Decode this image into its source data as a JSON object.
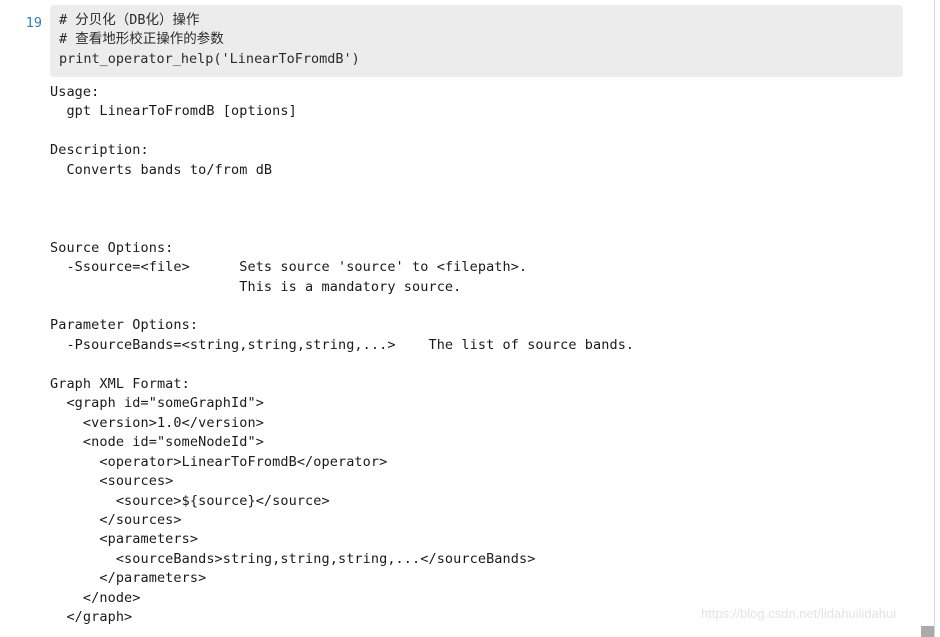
{
  "notebook": {
    "cell": {
      "prompt_label": "19",
      "input_code": "# 分贝化（DB化）操作\n# 查看地形校正操作的参数\nprint_operator_help('LinearToFromdB')",
      "input_lines": [
        "# 分贝化（DB化）操作",
        "# 查看地形校正操作的参数",
        "print_operator_help('LinearToFromdB')"
      ],
      "output_text": "Usage:\n  gpt LinearToFromdB [options]\n\nDescription:\n  Converts bands to/from dB\n\n\n\nSource Options:\n  -Ssource=<file>      Sets source 'source' to <filepath>.\n                       This is a mandatory source.\n\nParameter Options:\n  -PsourceBands=<string,string,string,...>    The list of source bands.\n\nGraph XML Format:\n  <graph id=\"someGraphId\">\n    <version>1.0</version>\n    <node id=\"someNodeId\">\n      <operator>LinearToFromdB</operator>\n      <sources>\n        <source>${source}</source>\n      </sources>\n      <parameters>\n        <sourceBands>string,string,string,...</sourceBands>\n      </parameters>\n    </node>\n  </graph>",
      "output_lines": [
        "Usage:",
        "  gpt LinearToFromdB [options]",
        "",
        "Description:",
        "  Converts bands to/from dB",
        "",
        "",
        "",
        "Source Options:",
        "  -Ssource=<file>      Sets source 'source' to <filepath>.",
        "                       This is a mandatory source.",
        "",
        "Parameter Options:",
        "  -PsourceBands=<string,string,string,...>    The list of source bands.",
        "",
        "Graph XML Format:",
        "  <graph id=\"someGraphId\">",
        "    <version>1.0</version>",
        "    <node id=\"someNodeId\">",
        "      <operator>LinearToFromdB</operator>",
        "      <sources>",
        "        <source>${source}</source>",
        "      </sources>",
        "      <parameters>",
        "        <sourceBands>string,string,string,...</sourceBands>",
        "      </parameters>",
        "    </node>",
        "  </graph>"
      ]
    }
  },
  "watermark": {
    "text": "https://blog.csdn.net/lidahuilidahui"
  },
  "colors": {
    "prompt_blue": "#307FC1",
    "input_background": "#ECECEC",
    "output_text": "#1a1a1a",
    "watermark": "#e3e3e3",
    "scrollbar": "#ababab"
  }
}
